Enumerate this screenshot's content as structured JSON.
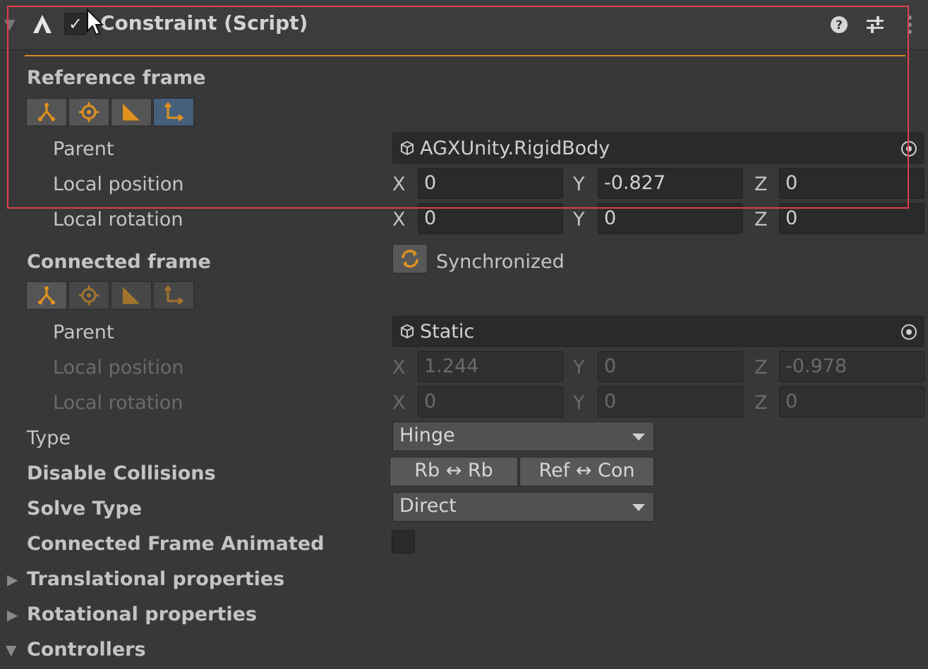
{
  "header": {
    "title": "Constraint (Script)",
    "enabled": true,
    "icons": [
      "constraint-icon",
      "help-icon",
      "presets-icon",
      "more-icon"
    ]
  },
  "reference_frame": {
    "label": "Reference frame",
    "parent_label": "Parent",
    "parent_value": "AGXUnity.RigidBody",
    "local_position_label": "Local position",
    "local_rotation_label": "Local rotation",
    "position": {
      "x": "0",
      "y": "-0.827",
      "z": "0"
    },
    "rotation": {
      "x": "0",
      "y": "0",
      "z": "0"
    },
    "selected_tool": "frame-axes"
  },
  "connected_frame": {
    "label": "Connected frame",
    "sync_label": "Synchronized",
    "parent_label": "Parent",
    "parent_value": "Static",
    "local_position_label": "Local position",
    "local_rotation_label": "Local rotation",
    "position": {
      "x": "1.244",
      "y": "0",
      "z": "-0.978"
    },
    "rotation": {
      "x": "0",
      "y": "0",
      "z": "0"
    },
    "selected_tool": "constraint"
  },
  "axes": {
    "x": "X",
    "y": "Y",
    "z": "Z"
  },
  "type": {
    "label": "Type",
    "value": "Hinge"
  },
  "disable_collisions": {
    "label": "Disable Collisions",
    "rb_rb": "Rb ↔ Rb",
    "ref_con": "Ref ↔ Con"
  },
  "solve_type": {
    "label": "Solve Type",
    "value": "Direct"
  },
  "connected_frame_animated": {
    "label": "Connected Frame Animated",
    "checked": false
  },
  "sections": {
    "translational": "Translational properties",
    "rotational": "Rotational properties",
    "controllers": "Controllers"
  },
  "colors": {
    "accent": "#d8891e",
    "selection": "#46607c",
    "highlight_box": "#e0404b"
  }
}
